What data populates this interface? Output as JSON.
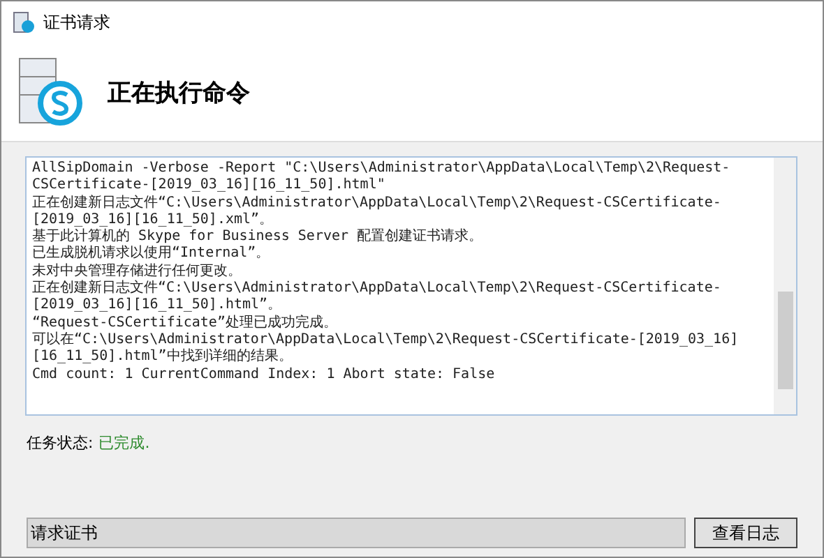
{
  "window": {
    "title": "证书请求"
  },
  "header": {
    "title": "正在执行命令"
  },
  "log": {
    "lines": [
      "AllSipDomain -Verbose -Report \"C:\\Users\\Administrator\\AppData\\Local\\Temp\\2\\Request-",
      "CSCertificate-[2019_03_16][16_11_50].html\"",
      "正在创建新日志文件“C:\\Users\\Administrator\\AppData\\Local\\Temp\\2\\Request-CSCertificate-",
      "[2019_03_16][16_11_50].xml”。",
      "基于此计算机的 Skype for Business Server 配置创建证书请求。",
      "已生成脱机请求以使用“Internal”。",
      "未对中央管理存储进行任何更改。",
      "正在创建新日志文件“C:\\Users\\Administrator\\AppData\\Local\\Temp\\2\\Request-CSCertificate-",
      "[2019_03_16][16_11_50].html”。",
      "“Request-CSCertificate”处理已成功完成。",
      "可以在“C:\\Users\\Administrator\\AppData\\Local\\Temp\\2\\Request-CSCertificate-[2019_03_16]",
      "[16_11_50].html”中找到详细的结果。",
      "Cmd count: 1 CurrentCommand Index: 1 Abort state: False"
    ]
  },
  "status": {
    "label": "任务状态:",
    "value": "已完成."
  },
  "progress": {
    "label": "请求证书",
    "level": 1
  },
  "buttons": [
    "查看日志"
  ]
}
